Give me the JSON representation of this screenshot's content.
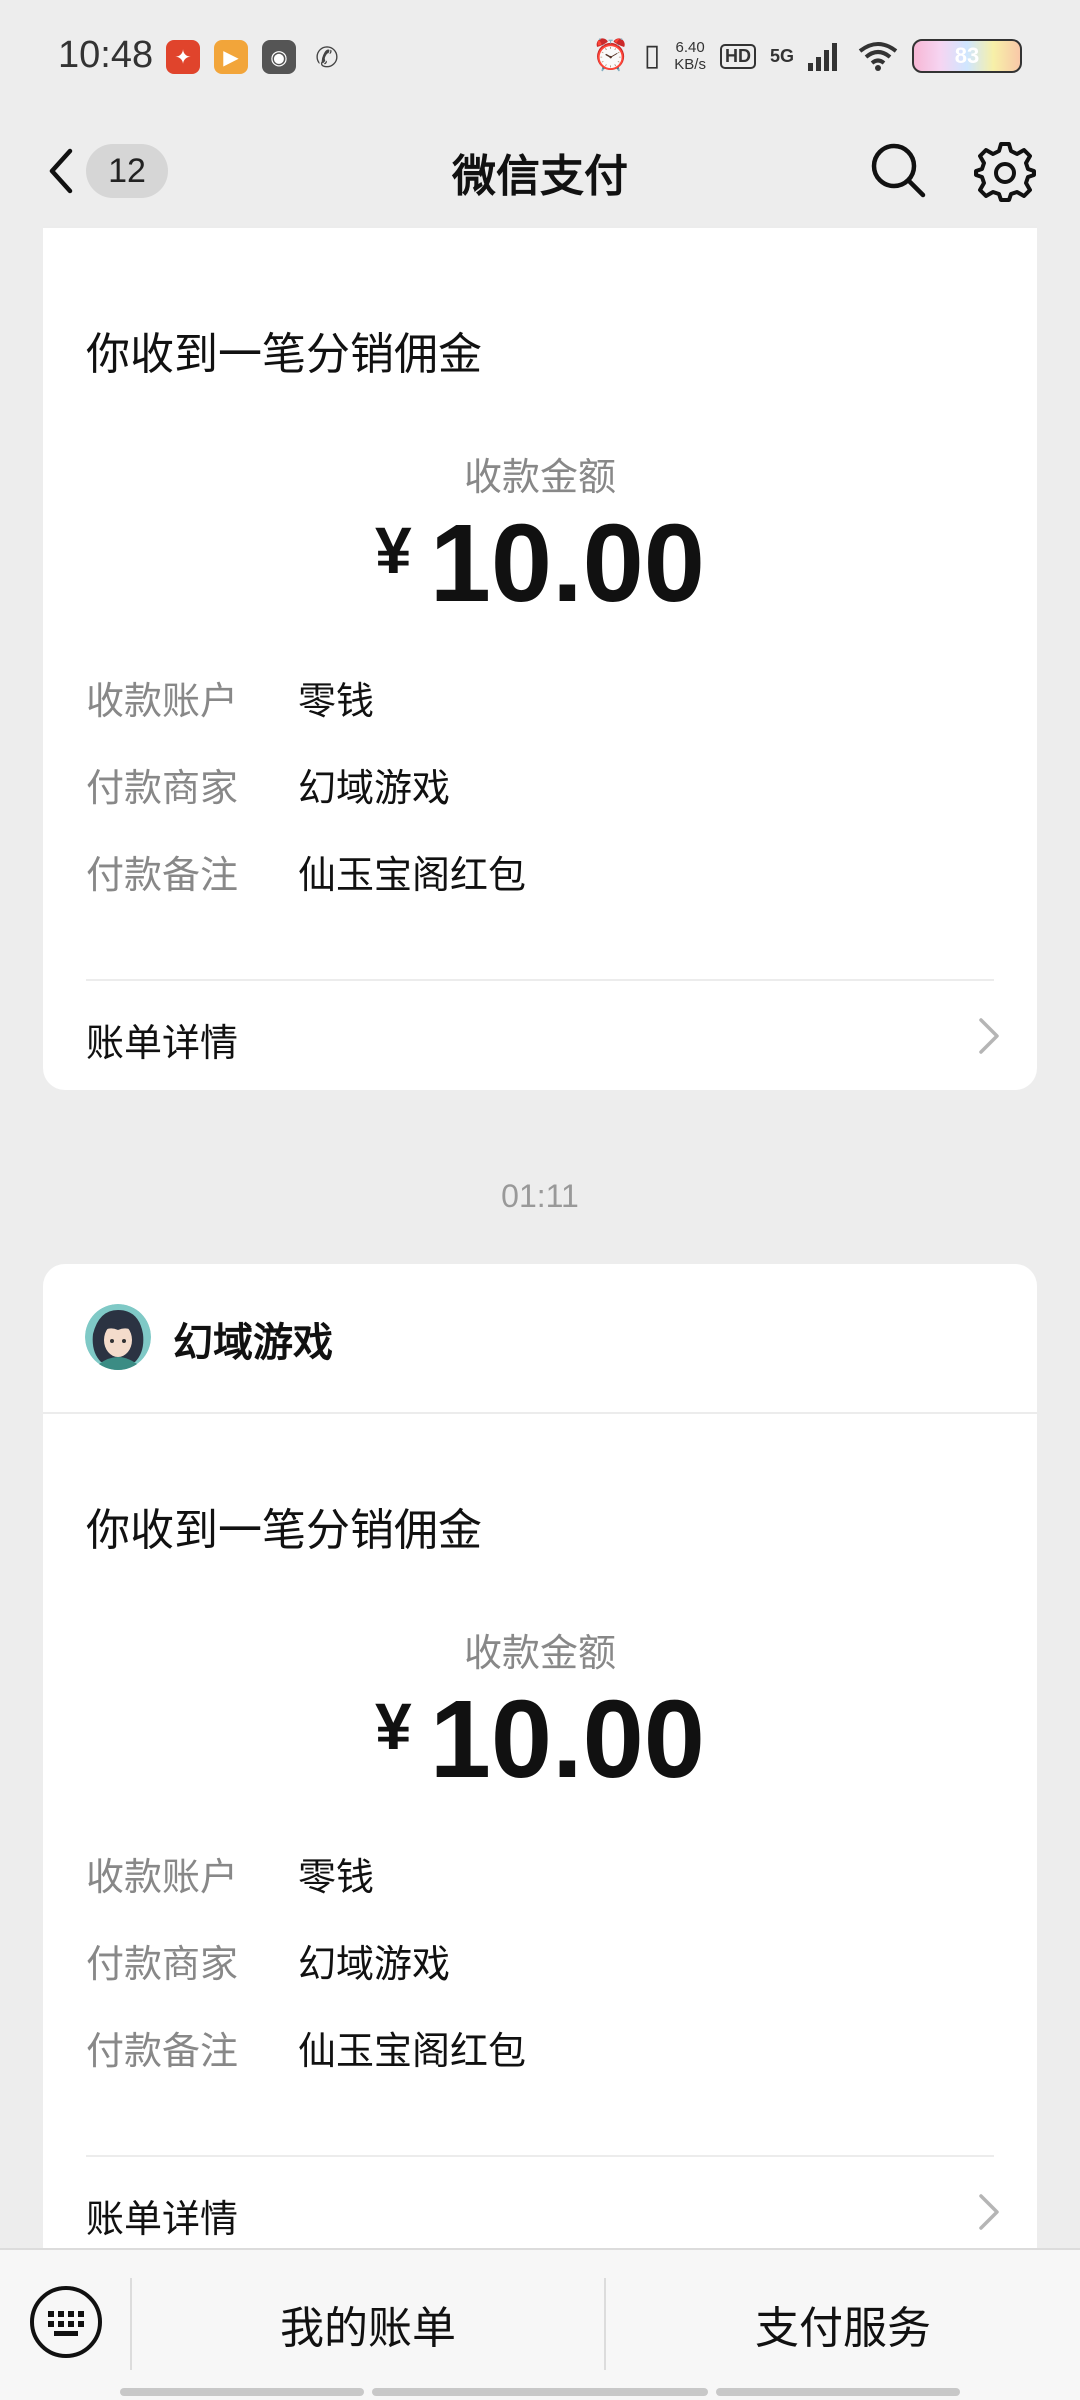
{
  "status_bar": {
    "time": "10:48",
    "net_speed_value": "6.40",
    "net_speed_unit": "KB/s",
    "hd_label": "HD",
    "signal_label": "5G",
    "battery": "83"
  },
  "header": {
    "unread_count": "12",
    "title": "微信支付"
  },
  "messages": [
    {
      "notice_title": "你收到一笔分销佣金",
      "amount_label": "收款金额",
      "currency": "¥",
      "amount": "10.00",
      "details": [
        {
          "key": "收款账户",
          "value": "零钱"
        },
        {
          "key": "付款商家",
          "value": "幻域游戏"
        },
        {
          "key": "付款备注",
          "value": "仙玉宝阁红包"
        }
      ],
      "bill_link": "账单详情"
    },
    {
      "timestamp": "01:11",
      "merchant": "幻域游戏",
      "notice_title": "你收到一笔分销佣金",
      "amount_label": "收款金额",
      "currency": "¥",
      "amount": "10.00",
      "details": [
        {
          "key": "收款账户",
          "value": "零钱"
        },
        {
          "key": "付款商家",
          "value": "幻域游戏"
        },
        {
          "key": "付款备注",
          "value": "仙玉宝阁红包"
        }
      ],
      "bill_link": "账单详情"
    }
  ],
  "bottom_menu": {
    "items": [
      {
        "label": "我的账单"
      },
      {
        "label": "支付服务"
      }
    ]
  },
  "icons": {
    "back": "chevron-left-icon",
    "search": "search-icon",
    "settings": "gear-icon",
    "keyboard": "keyboard-icon",
    "bill_chevron": "chevron-right-icon"
  }
}
